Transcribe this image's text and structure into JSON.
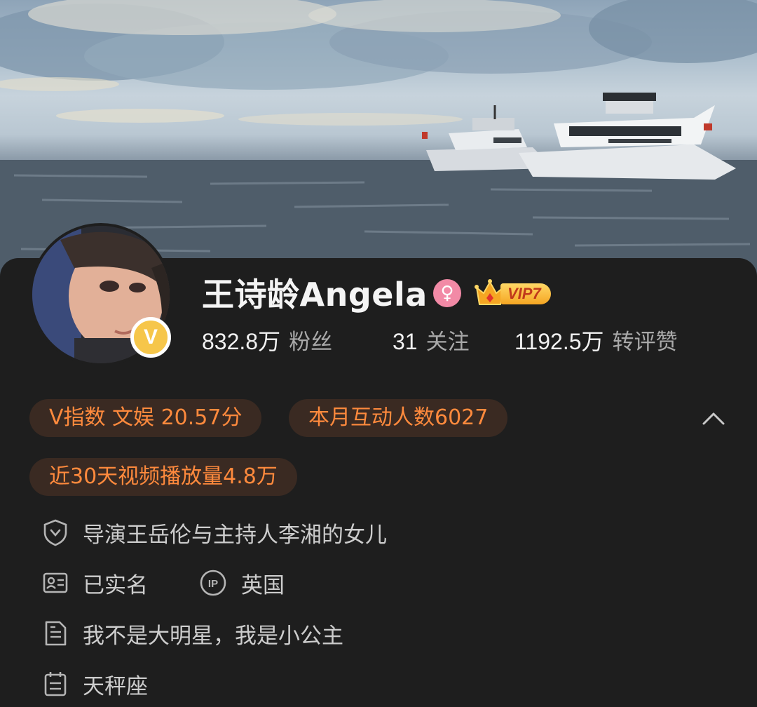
{
  "profile": {
    "name": "王诗龄Angela",
    "gender_icon": "female-symbol-icon",
    "vip_level": "VIP7",
    "verified_badge": "V",
    "stats": [
      {
        "value": "832.8万",
        "label": "粉丝"
      },
      {
        "value": "31",
        "label": "关注"
      },
      {
        "value": "1192.5万",
        "label": "转评赞"
      }
    ]
  },
  "tags": {
    "v_index": "V指数 文娱 20.57分",
    "monthly_interactions": "本月互动人数6027",
    "video_views": "近30天视频播放量4.8万"
  },
  "info": {
    "verification": "导演王岳伦与主持人李湘的女儿",
    "real_name": "已实名",
    "ip_badge": "IP",
    "ip_location": "英国",
    "bio": "我不是大明星，我是小公主",
    "zodiac": "天秤座"
  },
  "colors": {
    "accent_orange": "#ff8a3d",
    "tag_bg": "#3a2a22",
    "card_bg": "#1e1e1e",
    "verified_gold": "#f6c64a",
    "gender_pink": "#f28aa6"
  }
}
